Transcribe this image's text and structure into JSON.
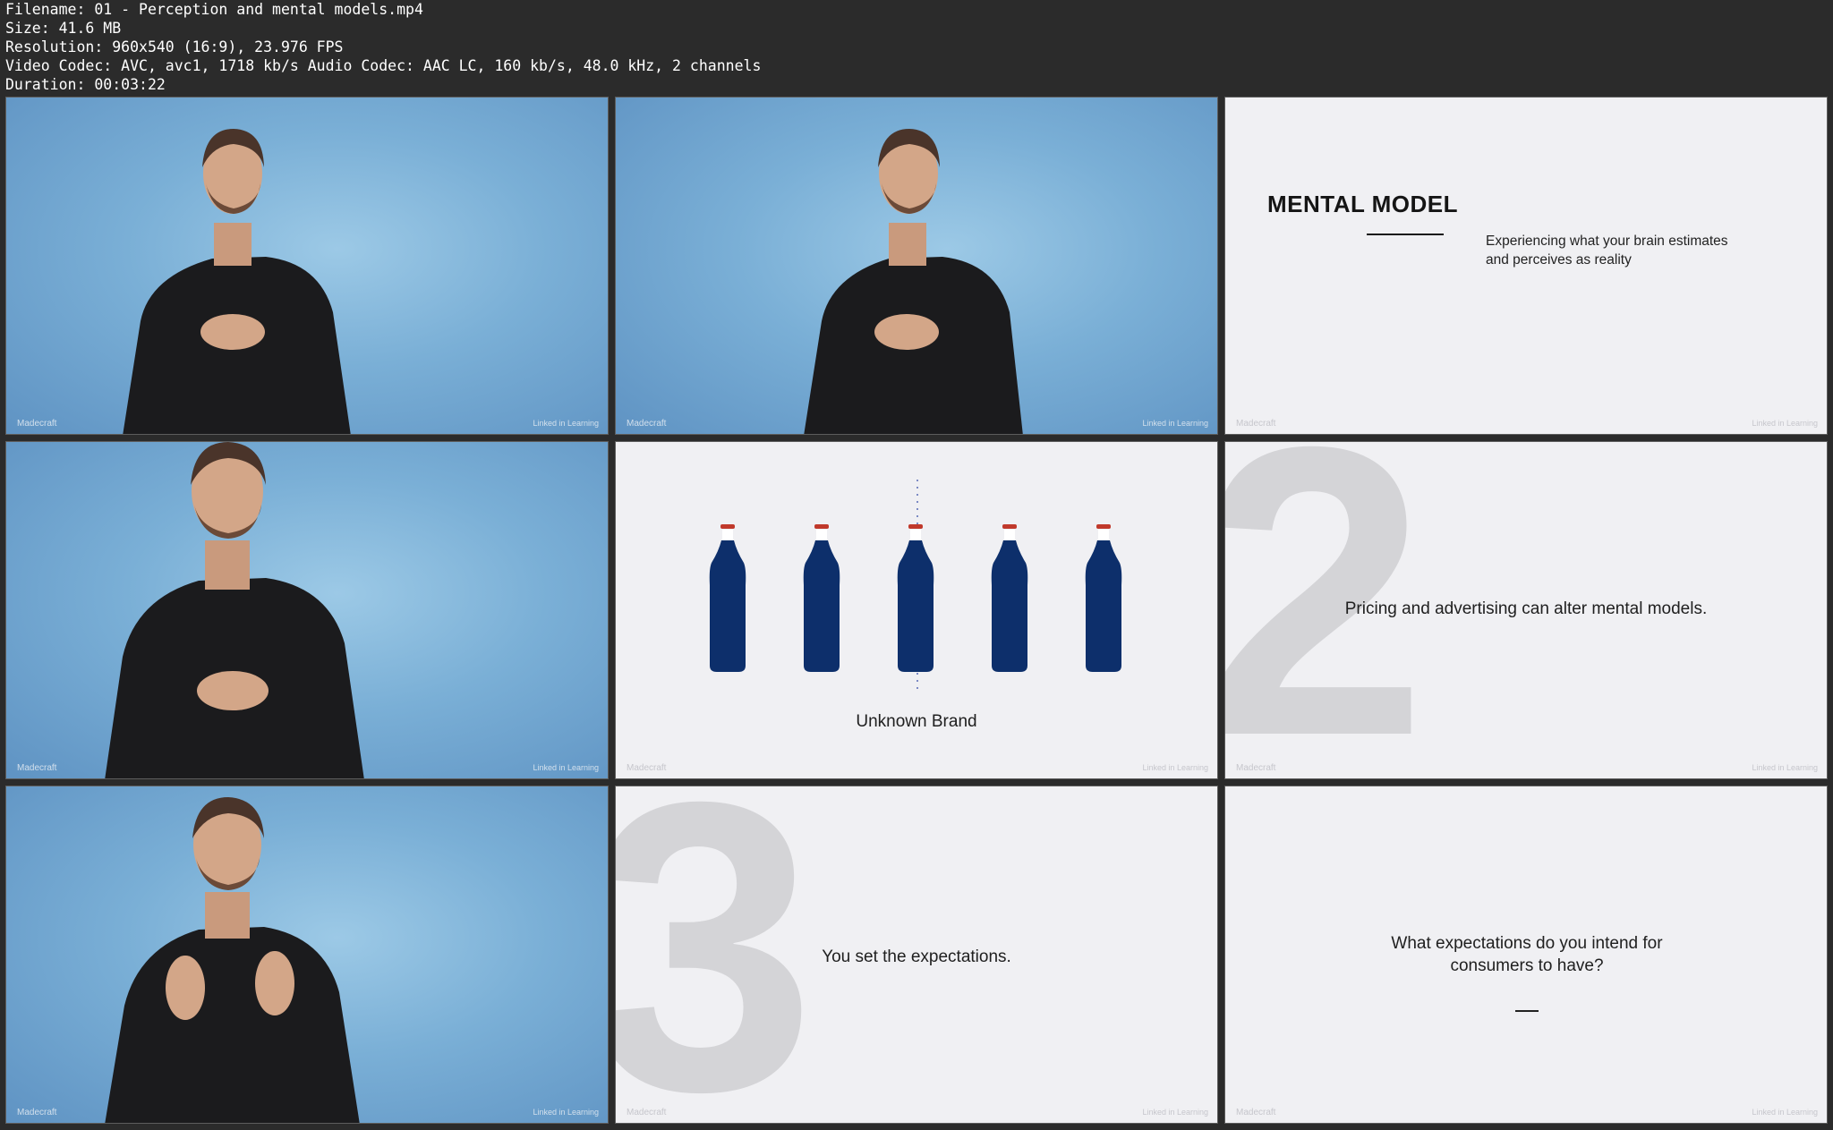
{
  "header": {
    "filename": "Filename: 01 - Perception and mental models.mp4",
    "size": "Size: 41.6 MB",
    "resolution": "Resolution: 960x540 (16:9), 23.976 FPS",
    "codec": "Video Codec: AVC, avc1, 1718 kb/s Audio Codec: AAC LC, 160 kb/s, 48.0 kHz, 2 channels",
    "duration": "Duration: 00:03:22"
  },
  "watermarks": {
    "left": "Madecraft",
    "right": "Linked in Learning"
  },
  "colors": {
    "background": "#2b2b2b",
    "video_bg": "#7aafd6",
    "slide_bg": "#f0f0f3",
    "bottle": "#0d2f6b",
    "bottle_cap": "#c0392b",
    "big_digit": "#d4d4d7"
  },
  "frames": {
    "f3": {
      "title": "MENTAL MODEL",
      "description": "Experiencing what your brain estimates and perceives as reality"
    },
    "f5": {
      "caption": "Unknown Brand",
      "bottle_count": 5
    },
    "f6": {
      "digit": "2",
      "text": "Pricing and advertising can alter mental models."
    },
    "f8": {
      "digit": "3",
      "text": "You set the expectations."
    },
    "f9": {
      "text": "What expectations do you intend for consumers to have?"
    }
  }
}
